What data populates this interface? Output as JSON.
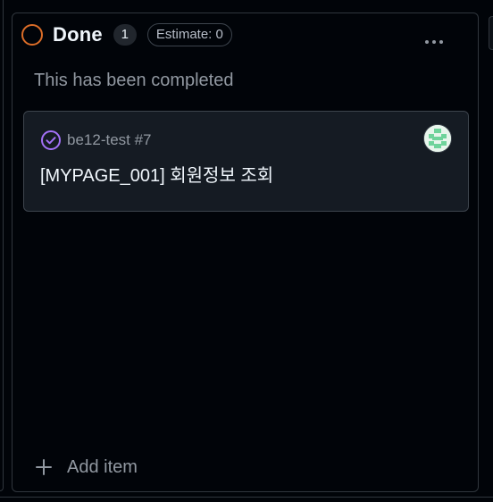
{
  "column": {
    "title": "Done",
    "count": "1",
    "estimate": "Estimate: 0",
    "description": "This has been completed",
    "status_color": "#db6d28",
    "menu_icon": "kebab-horizontal-icon"
  },
  "card": {
    "repo_ref": "be12-test #7",
    "title": "[MYPAGE_001] 회원정보 조회",
    "status_icon": "issue-closed-icon",
    "status_icon_color": "#a371f7",
    "avatar": "user-avatar"
  },
  "footer": {
    "add_label": "Add item",
    "add_icon": "plus-icon"
  }
}
